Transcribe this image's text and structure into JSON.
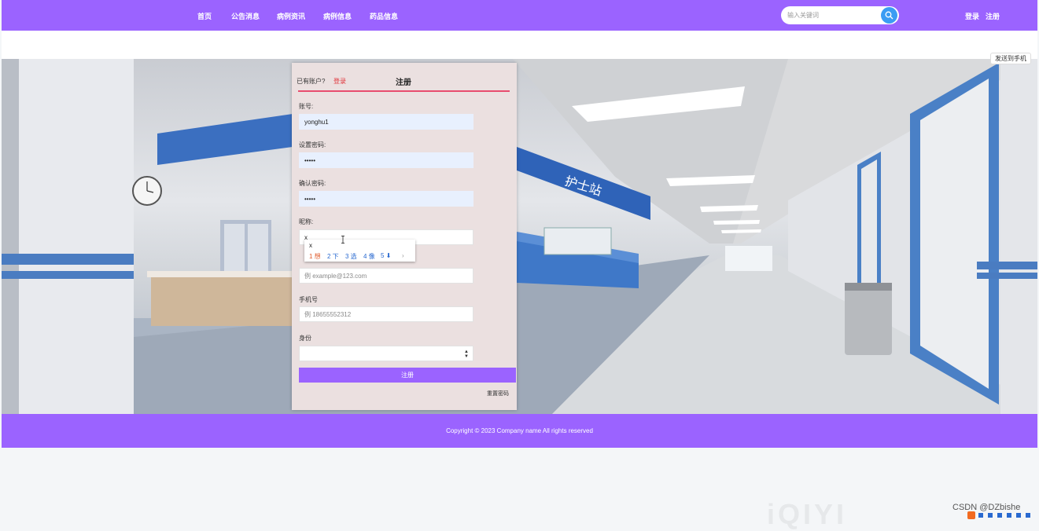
{
  "nav": {
    "items": [
      "首页",
      "公告消息",
      "病例资讯",
      "病例信息",
      "药品信息"
    ],
    "search_placeholder": "输入关键词",
    "login": "登录",
    "register": "注册"
  },
  "send_phone": "发送到手机",
  "form": {
    "have_account": "已有账户?",
    "login_link": "登录",
    "title": "注册",
    "fields": {
      "account": {
        "label": "账号:",
        "value": "yonghu1"
      },
      "password": {
        "label": "设置密码:",
        "value": "•••••"
      },
      "confirm": {
        "label": "确认密码:",
        "value": "•••••"
      },
      "nickname": {
        "label": "昵称:",
        "value": "x"
      },
      "email": {
        "placeholder": "例 example@123.com"
      },
      "phone": {
        "label": "手机号",
        "placeholder": "例 18655552312"
      },
      "identity": {
        "label": "身份"
      }
    },
    "submit": "注册",
    "reset": "重置密码"
  },
  "ime": {
    "pinyin": "x",
    "candidates": [
      "1 想",
      "2 下",
      "3 选",
      "4 像",
      "5 ⬇"
    ],
    "next": "›"
  },
  "footer": {
    "copyright": "Copyright © 2023 Company name All rights reserved"
  },
  "watermark": "CSDN @DZbishe",
  "logo_text": "iQIYI",
  "colors": {
    "accent": "#9b63ff",
    "input_filled": "#e8f0fe",
    "card": "#ebe0e0",
    "line": "#e84c6e"
  }
}
